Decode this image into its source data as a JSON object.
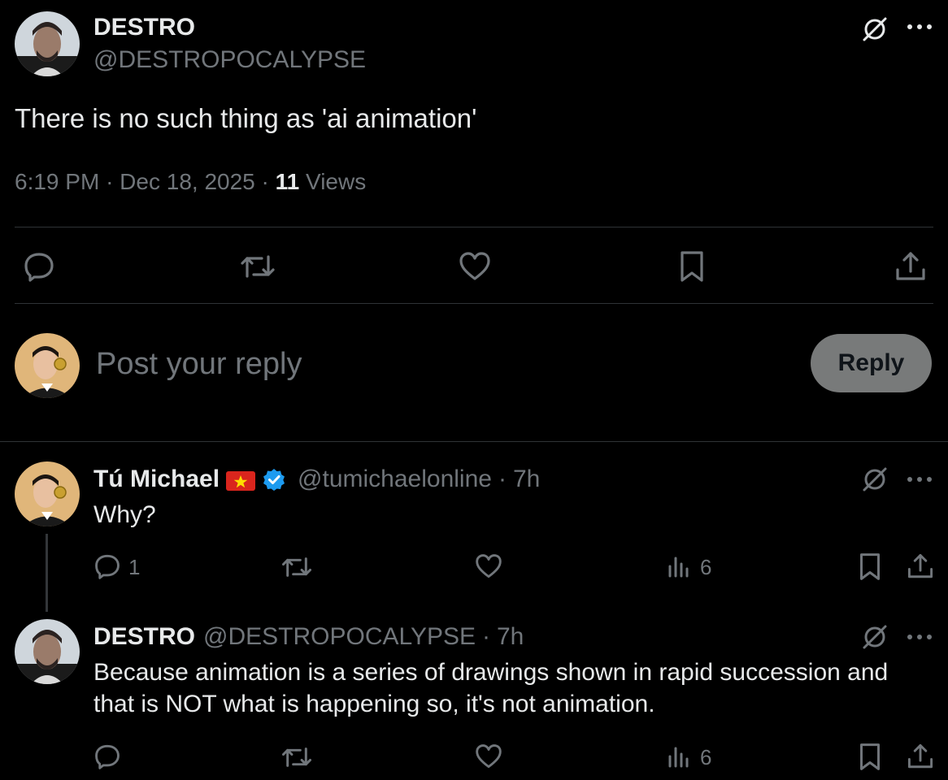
{
  "main_tweet": {
    "display_name": "DESTRO",
    "handle": "@DESTROPOCALYPSE",
    "text": "There is no such thing as 'ai animation'",
    "time": "6:19 PM",
    "date": "Dec 18, 2025",
    "views_count": "11",
    "views_label": "Views",
    "sep": "·"
  },
  "composer": {
    "placeholder": "Post your reply",
    "reply_label": "Reply"
  },
  "replies": [
    {
      "display_name": "Tú Michael",
      "handle": "@tumichaelonline",
      "age": "7h",
      "text": "Why?",
      "reply_count": "1",
      "views_count": "6"
    },
    {
      "display_name": "DESTRO",
      "handle": "@DESTROPOCALYPSE",
      "age": "7h",
      "text_line1": "Because animation is a series of drawings shown in rapid succession and",
      "text_line2": "that is NOT what is happening so, it's not animation.",
      "views_count": "6"
    }
  ],
  "icons": {
    "grok": "grok-icon",
    "more": "more-icon",
    "reply": "reply-icon",
    "repost": "repost-icon",
    "like": "like-icon",
    "bookmark": "bookmark-icon",
    "share": "share-icon",
    "views": "views-icon",
    "flag": "vietnam-flag-icon",
    "verified": "verified-badge-icon"
  },
  "colors": {
    "background": "#000000",
    "text": "#e7e9ea",
    "muted": "#71767b",
    "verified": "#1d9bf0",
    "reply_button": "#787a7a"
  }
}
